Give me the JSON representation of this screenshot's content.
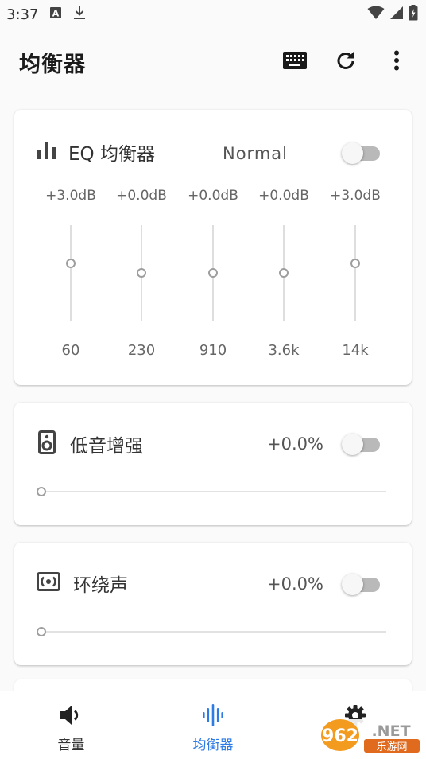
{
  "status_bar": {
    "time": "3:37",
    "icons": [
      "a-notification-icon",
      "download-icon",
      "wifi-icon",
      "signal-icon",
      "battery-icon"
    ]
  },
  "app_bar": {
    "title": "均衡器",
    "actions": [
      "keyboard-icon",
      "refresh-icon",
      "more-vert-icon"
    ]
  },
  "eq_card": {
    "title": "EQ 均衡器",
    "preset": "Normal",
    "enabled": false,
    "bands": [
      {
        "gain": "+3.0dB",
        "freq": "60",
        "level": 0.6
      },
      {
        "gain": "+0.0dB",
        "freq": "230",
        "level": 0.5
      },
      {
        "gain": "+0.0dB",
        "freq": "910",
        "level": 0.5
      },
      {
        "gain": "+0.0dB",
        "freq": "3.6k",
        "level": 0.5
      },
      {
        "gain": "+3.0dB",
        "freq": "14k",
        "level": 0.6
      }
    ]
  },
  "bass_card": {
    "title": "低音增强",
    "value": "+0.0%",
    "enabled": false,
    "level": 0
  },
  "surround_card": {
    "title": "环绕声",
    "value": "+0.0%",
    "enabled": false,
    "level": 0
  },
  "bottom_nav": {
    "items": [
      {
        "label": "音量",
        "icon": "volume-icon",
        "active": false
      },
      {
        "label": "均衡器",
        "icon": "equalizer-icon",
        "active": true
      },
      {
        "label": "",
        "icon": "settings-icon",
        "active": false
      }
    ]
  },
  "watermark": {
    "text_top": "962.NET",
    "text_bottom": "乐游网"
  },
  "colors": {
    "accent": "#2f7be6",
    "switch_off_track": "#b9b9b9",
    "text_muted": "#666666"
  }
}
